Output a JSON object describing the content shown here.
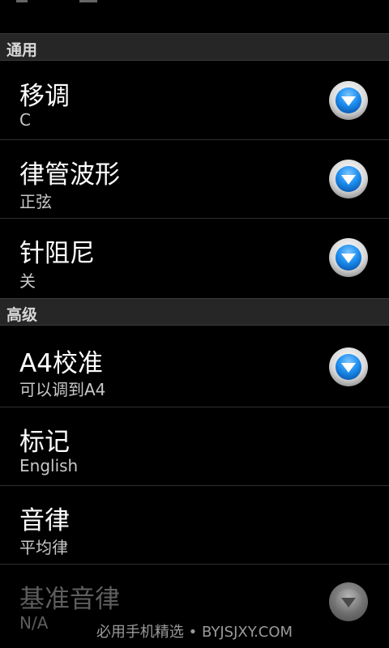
{
  "sections": [
    {
      "title": "通用"
    },
    {
      "title": "高级"
    }
  ],
  "prefs": {
    "transpose": {
      "title": "移调",
      "summary": "C"
    },
    "waveform": {
      "title": "律管波形",
      "summary": "正弦"
    },
    "needle_damping": {
      "title": "针阻尼",
      "summary": "关"
    },
    "a4_calibration": {
      "title": "A4校准",
      "summary": "可以调到A4"
    },
    "notation": {
      "title": "标记",
      "summary": "English"
    },
    "temperament": {
      "title": "音律",
      "summary": "平均律"
    },
    "base_temperament": {
      "title": "基准音律",
      "summary": "N/A"
    }
  },
  "watermark": "必用手机精选 • BYJSJXY.COM",
  "colors": {
    "accent_blue": "#1e8ff0",
    "background": "#000000",
    "section_header": "#262626",
    "disabled_text": "#5e5e5e"
  },
  "icons": {
    "dropdown": "chevron-down-circle-icon"
  }
}
